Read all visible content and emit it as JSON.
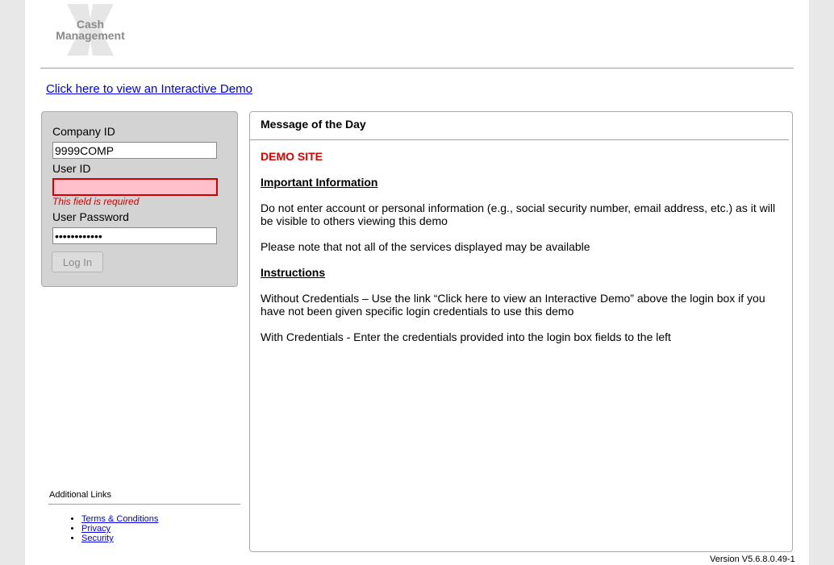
{
  "logo": {
    "line1": "Cash",
    "line2": "Management"
  },
  "demo_link": "Click here to view an Interactive Demo",
  "login": {
    "company_id_label": "Company ID",
    "company_id_value": "9999COMP",
    "user_id_label": "User ID",
    "user_id_value": "",
    "user_id_error": "This field is required",
    "password_label": "User Password",
    "password_value": "••••••••••••",
    "login_button": "Log In"
  },
  "additional_links": {
    "title": "Additional Links",
    "items": [
      "Terms & Conditions",
      "Privacy",
      "Security"
    ]
  },
  "message": {
    "title": "Message of the Day",
    "demo_site": "DEMO SITE",
    "important_heading": "Important Information",
    "important_p1": "Do not enter account or personal information (e.g., social security number, email address, etc.) as it will be visible to others viewing this demo",
    "important_p2": "Please note that not all of the services displayed may be available",
    "instructions_heading": "Instructions",
    "instructions_p1": "Without Credentials – Use the link “Click here to view an Interactive Demo” above the login box if you have not been given specific login credentials to use this demo",
    "instructions_p2": "With Credentials - Enter the credentials provided into the login box fields to the left"
  },
  "version": "Version V5.6.8.0.49-1",
  "colors": {
    "error": "#d00000",
    "error_bg": "#ffc0cb",
    "link": "#0000ee",
    "demo_site": "#e00000"
  }
}
